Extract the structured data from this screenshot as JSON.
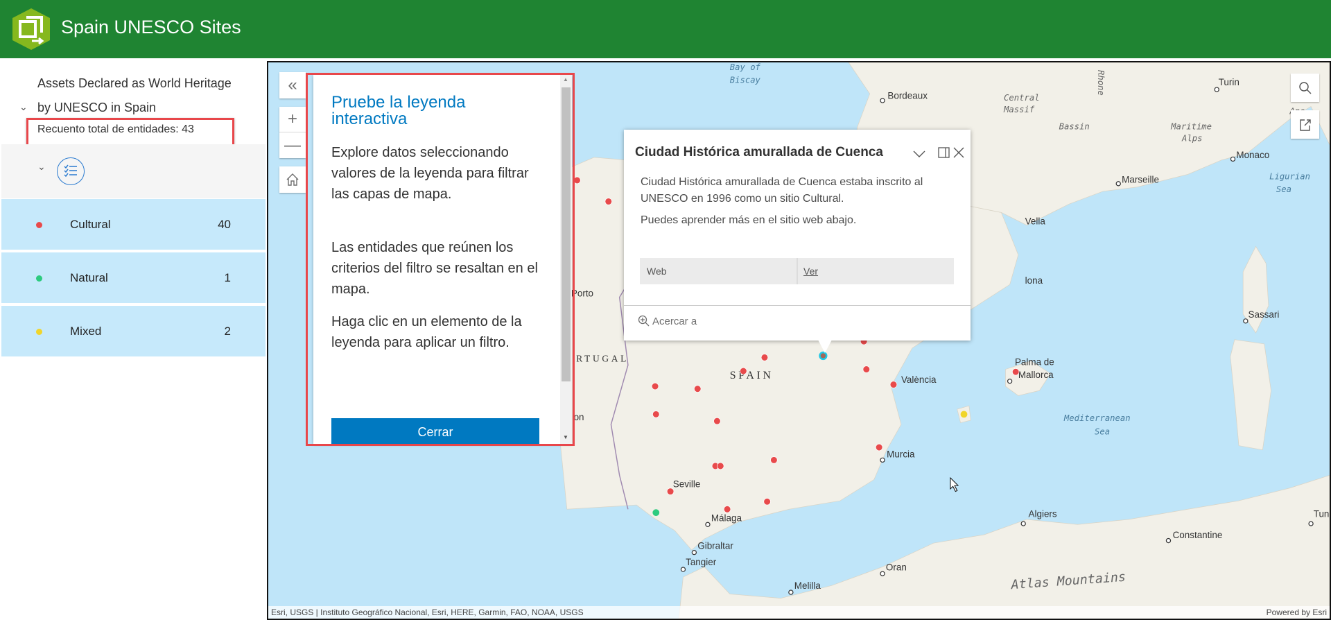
{
  "header": {
    "title": "Spain UNESCO Sites",
    "logo_icon": "app-logo-hexagon-icon",
    "color": "#1f8432"
  },
  "sidebar": {
    "layer_title_line1": "Assets Declared as World Heritage",
    "layer_title_line2": "by UNESCO in Spain",
    "feature_count": "Recuento total de entidades: 43",
    "legend": [
      {
        "label": "Cultural",
        "count": "40",
        "color": "#e84a4b"
      },
      {
        "label": "Natural",
        "count": "1",
        "color": "#2dcb7f"
      },
      {
        "label": "Mixed",
        "count": "2",
        "color": "#f0d52a"
      }
    ]
  },
  "map_controls": {
    "collapse": "collapse-icon",
    "zoom_in": "+",
    "zoom_out": "—",
    "home": "home-icon",
    "search": "search-icon",
    "share": "share-icon"
  },
  "tour": {
    "title": "Pruebe la leyenda interactiva",
    "p1": "Explore datos seleccionando valores de la leyenda para filtrar las capas de mapa.",
    "p2": "Las entidades que reúnen los criterios del filtro se resaltan en el mapa.",
    "p3": "Haga clic en un elemento de la leyenda para aplicar un filtro.",
    "close_label": "Cerrar"
  },
  "popup": {
    "title": "Ciudad Histórica amurallada de Cuenca",
    "text1": "Ciudad Histórica amurallada de Cuenca estaba inscrito al UNESCO en 1996 como un sitio Cultural.",
    "text2": "Puedes aprender más en el sitio web abajo.",
    "field_name": "Web",
    "field_value": "Ver",
    "zoom_to": "Acercar a"
  },
  "map": {
    "labels": [
      "Bordeaux",
      "Turin",
      "Monaco",
      "Marseille",
      "Sassari",
      "Porto",
      "Seville",
      "Málaga",
      "Gibraltar",
      "Tangier",
      "Melilla",
      "Oran",
      "Algiers",
      "Constantine",
      "Murcia",
      "València",
      "Palma de",
      "Mallorca",
      "Tun",
      "Vella",
      "lona",
      "on"
    ],
    "countries": [
      "SPAIN",
      "RTUGAL"
    ],
    "water": [
      "Bay of",
      "Biscay",
      "Ligurian",
      "Sea",
      "Mediterranean",
      "Sea"
    ],
    "terrain": [
      "Central",
      "Massif",
      "Bassin",
      "Maritime",
      "Alps",
      "Ape",
      "Rhone",
      "Atlas Mountains"
    ],
    "attribution": "Esri, USGS | Instituto Geográfico Nacional, Esri, HERE, Garmin, FAO, NOAA, USGS",
    "powered_by": "Powered by Esri"
  }
}
